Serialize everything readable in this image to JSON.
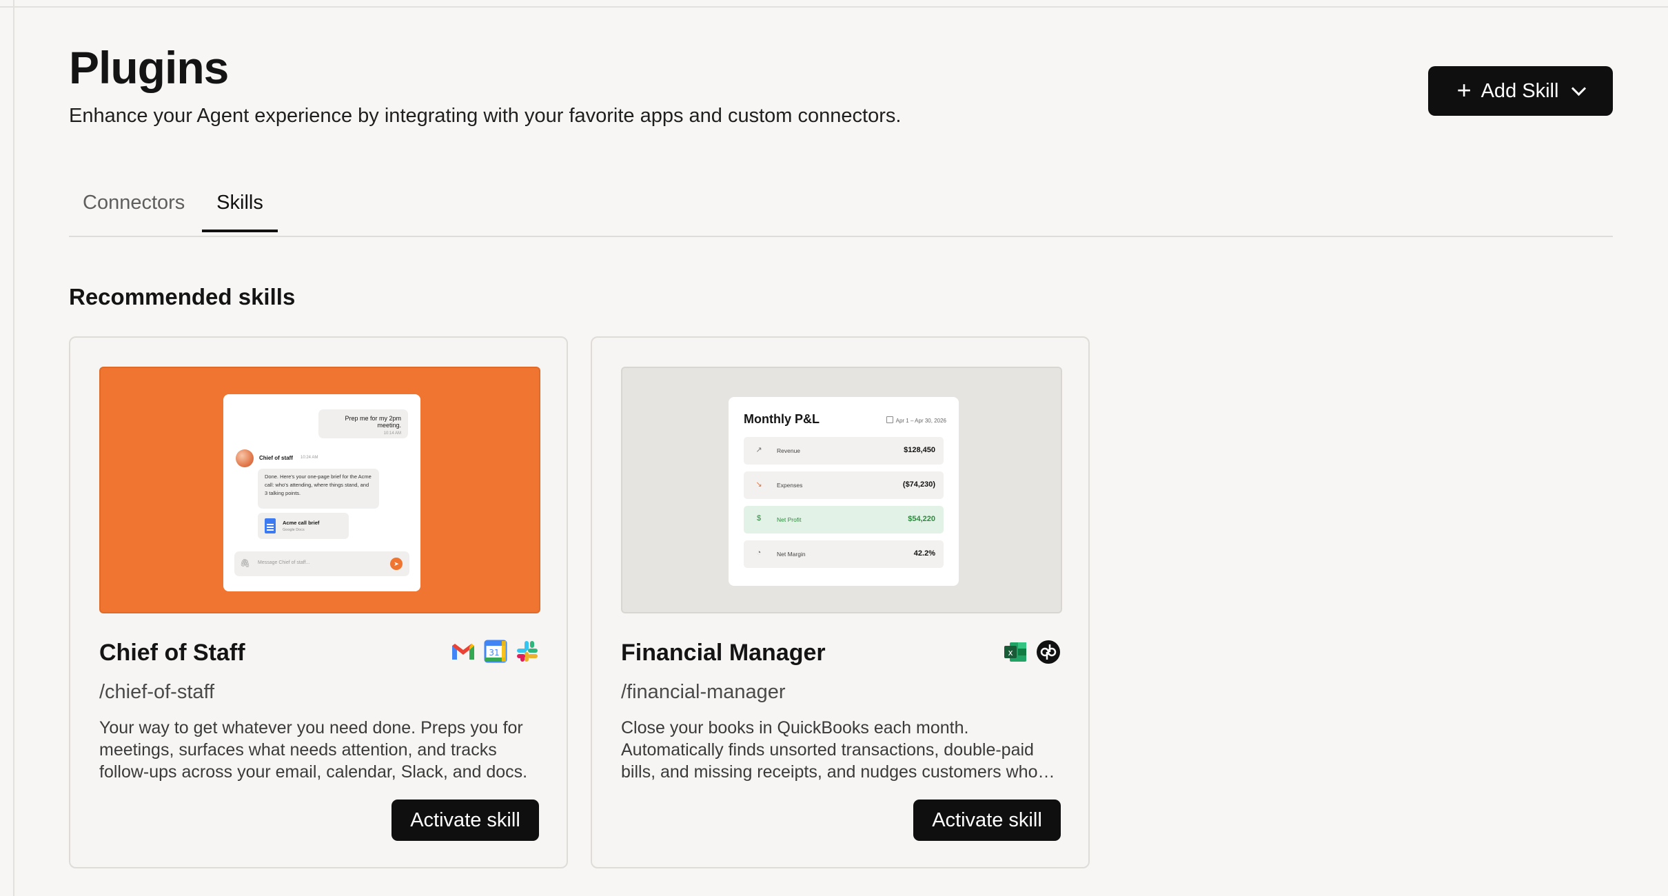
{
  "page": {
    "title": "Plugins",
    "subtitle": "Enhance your Agent experience by integrating with your favorite apps and custom connectors."
  },
  "header": {
    "add_skill_label": "Add Skill"
  },
  "tabs": [
    {
      "label": "Connectors",
      "active": false
    },
    {
      "label": "Skills",
      "active": true
    }
  ],
  "section": {
    "title": "Recommended skills"
  },
  "skills": [
    {
      "name": "Chief of Staff",
      "slug": "/chief-of-staff",
      "description": "Your way to get whatever you need done. Preps you for meetings, surfaces what needs attention, and tracks follow-ups across your email, calendar, Slack, and docs.",
      "button": "Activate skill",
      "apps": [
        "gmail-icon",
        "google-calendar-icon",
        "slack-icon"
      ],
      "preview": {
        "user_message": "Prep me for my 2pm meeting.",
        "user_time": "10:14 AM",
        "assistant_name": "Chief of staff",
        "assistant_time": "10:24 AM",
        "assistant_message": "Done. Here's your one-page brief for the Acme call: who's attending, where things stand, and 3 talking points.",
        "doc_title": "Acme call brief",
        "doc_source": "Google Docs",
        "input_placeholder": "Message Chief of staff..."
      },
      "accent": "#ef7530"
    },
    {
      "name": "Financial Manager",
      "slug": "/financial-manager",
      "description": "Close your books in QuickBooks each month. Automatically finds unsorted transactions, double-paid bills, and missing receipts, and nudges customers who…",
      "button": "Activate skill",
      "apps": [
        "excel-icon",
        "quickbooks-icon"
      ],
      "preview": {
        "title": "Monthly P&L",
        "date_range": "Apr 1 – Apr 30, 2026",
        "rows": [
          {
            "label": "Revenue",
            "value": "$128,450",
            "icon": "trend-up-icon"
          },
          {
            "label": "Expenses",
            "value": "($74,230)",
            "icon": "trend-down-icon"
          },
          {
            "label": "Net Profit",
            "value": "$54,220",
            "icon": "dollar-icon"
          },
          {
            "label": "Net Margin",
            "value": "42.2%",
            "icon": "pie-icon"
          }
        ]
      }
    }
  ]
}
